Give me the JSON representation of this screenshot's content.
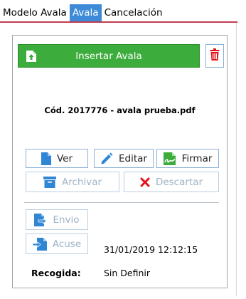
{
  "tabs": [
    {
      "label": "Modelo Avala"
    },
    {
      "label": "Avala"
    },
    {
      "label": "Cancelación"
    }
  ],
  "panel": {
    "insert_label": "Insertar Avala",
    "file_name": "Cód. 2017776 - avala  prueba.pdf",
    "actions": {
      "ver": "Ver",
      "editar": "Editar",
      "firmar": "Firmar",
      "archivar": "Archivar",
      "descartar": "Descartar",
      "envio": "Envio",
      "acuse": "Acuse"
    },
    "acuse_date": "31/01/2019 12:12:15",
    "recogida_label": "Recogida:",
    "recogida_value": "Sin Definir"
  },
  "colors": {
    "tab_active": "#3d8ad8",
    "tab_underline": "#c23b53",
    "insert_green": "#3cac3c",
    "trash_red": "#e0141c",
    "icon_blue": "#2f86d4",
    "discard_red": "#e0141c"
  },
  "icons": {
    "insert": "document-upload-icon",
    "trash": "trash-icon",
    "ver": "document-icon",
    "editar": "pencil-icon",
    "firmar": "signature-icon",
    "archivar": "archive-icon",
    "descartar": "x-icon",
    "envio": "send-document-icon",
    "acuse": "receipt-icon"
  }
}
